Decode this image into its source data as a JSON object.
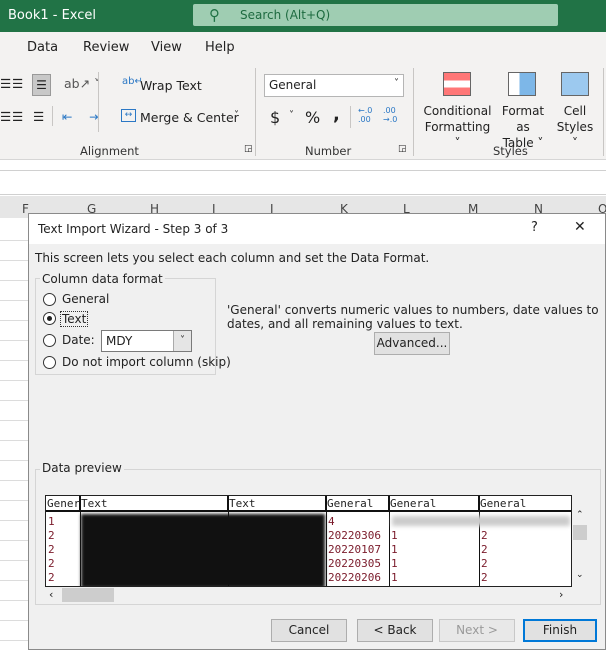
{
  "app": {
    "title": "Book1  -  Excel",
    "search_placeholder": "Search (Alt+Q)",
    "accent": "#217346"
  },
  "menu": [
    "Data",
    "Review",
    "View",
    "Help"
  ],
  "ribbon": {
    "wrap_text": "Wrap Text",
    "merge_center": "Merge & Center",
    "alignment_label": "Alignment",
    "number_format": "General",
    "currency": "$",
    "percent": "%",
    "comma": ",",
    "increase_decimal": "←.0 .00",
    "decrease_decimal": ".00 →.0",
    "number_label": "Number",
    "conditional_formatting": [
      "Conditional",
      "Formatting"
    ],
    "format_as_table": [
      "Format as",
      "Table"
    ],
    "cell_styles": [
      "Cell",
      "Styles"
    ],
    "styles_label": "Styles"
  },
  "sheet": {
    "columns": [
      "F",
      "G",
      "H",
      "I",
      "J",
      "K",
      "L",
      "M",
      "N",
      "O"
    ]
  },
  "dialog": {
    "title": "Text Import Wizard - Step 3 of 3",
    "help": "?",
    "close": "✕",
    "intro": "This screen lets you select each column and set the Data Format.",
    "group_label": "Column data format",
    "options": [
      {
        "label": "General",
        "selected": false
      },
      {
        "label": "Text",
        "selected": true
      },
      {
        "label": "Date:",
        "selected": false
      },
      {
        "label": "Do not import column (skip)",
        "selected": false
      }
    ],
    "date_format": "MDY",
    "description": "'General' converts numeric values to numbers, date values to dates, and all remaining values to text.",
    "advanced": "Advanced...",
    "preview_label": "Data preview",
    "preview": {
      "headers": [
        "Gener",
        "Text",
        "Text",
        "General",
        "General",
        "General"
      ],
      "rows": [
        [
          "1",
          "",
          "",
          "4",
          "",
          ""
        ],
        [
          "2",
          "",
          "",
          "20220306",
          "1",
          "2"
        ],
        [
          "2",
          "",
          "",
          "20220107",
          "1",
          "2"
        ],
        [
          "2",
          "",
          "",
          "20220305",
          "1",
          "2"
        ],
        [
          "2",
          "",
          "",
          "20220206",
          "1",
          "2"
        ]
      ]
    },
    "buttons": {
      "cancel": "Cancel",
      "back": "< Back",
      "next": "Next >",
      "finish": "Finish"
    }
  }
}
